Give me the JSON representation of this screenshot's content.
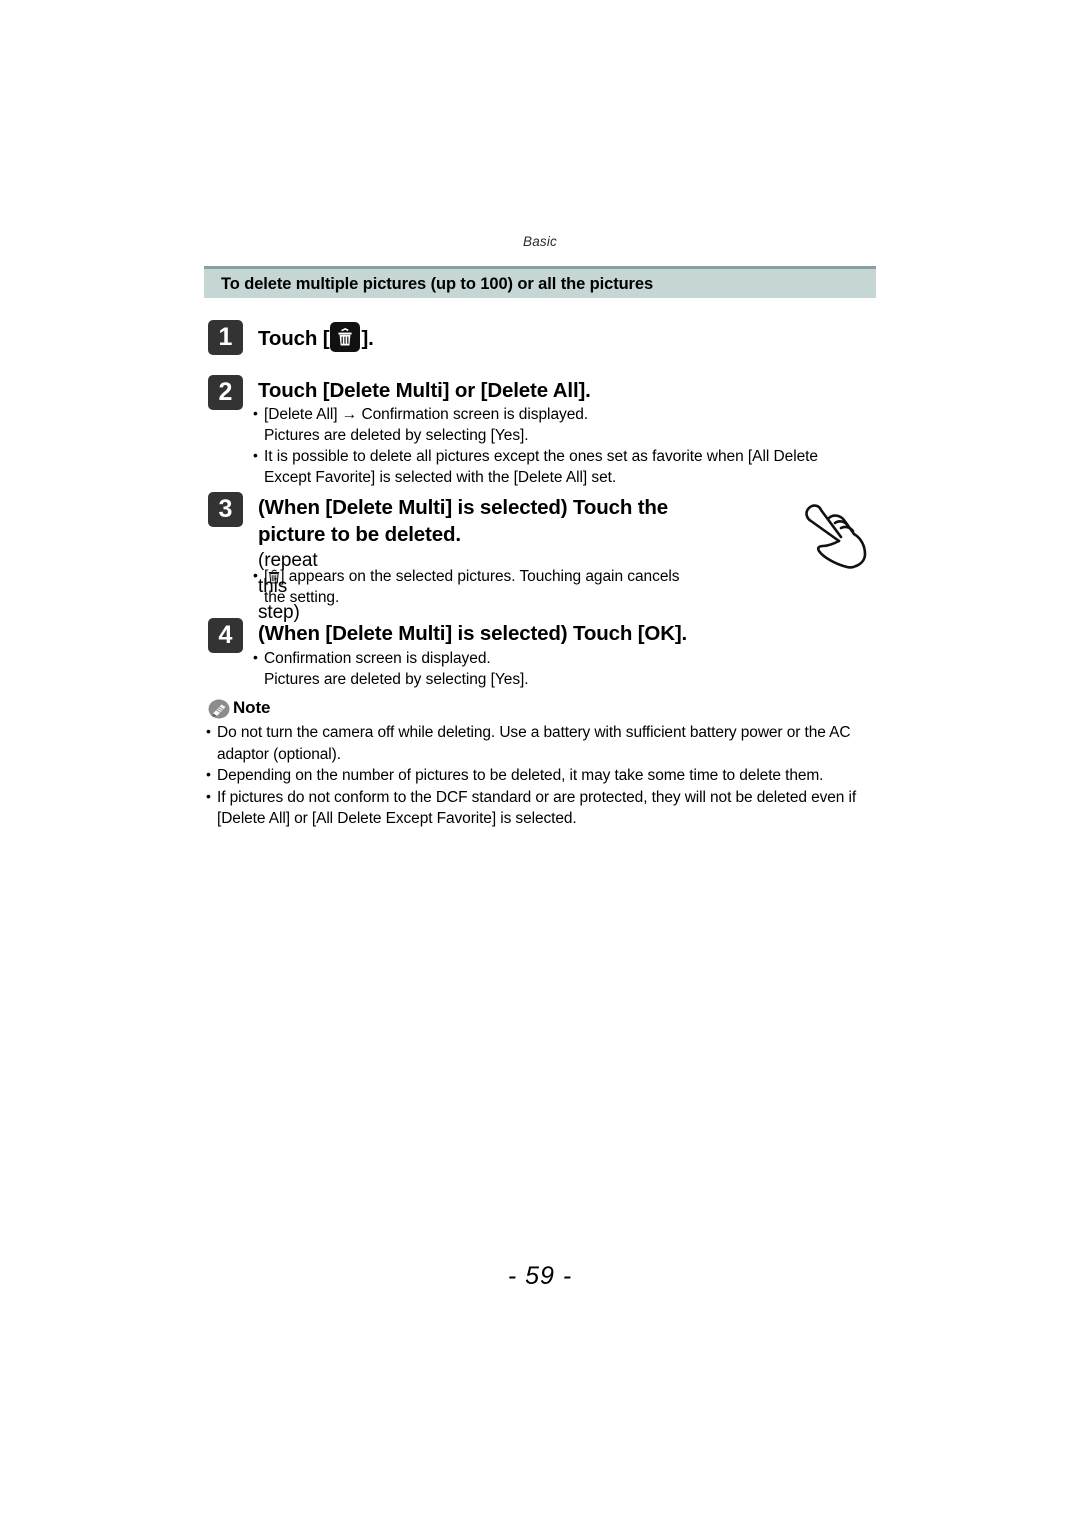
{
  "page": {
    "running_head": "Basic",
    "folio": "- 59 -"
  },
  "section": {
    "title": "To delete multiple pictures (up to 100) or all the pictures",
    "band_color": "#c6d6d4",
    "band_border_color": "#86a3a0"
  },
  "steps": [
    {
      "number": "1",
      "title_before_icon": "Touch [",
      "icon": "trash-icon",
      "title_after_icon": "].",
      "bullets": []
    },
    {
      "number": "2",
      "title": "Touch [Delete Multi] or [Delete All].",
      "bullets": [
        {
          "line1": "[Delete All] → Confirmation screen is displayed.",
          "line2": "Pictures are deleted by selecting [Yes]."
        },
        {
          "line1": "It is possible to delete all pictures except the ones set as favorite when  [All Delete",
          "line2": "Except Favorite]  is selected with the [Delete All] set."
        }
      ]
    },
    {
      "number": "3",
      "title": "(When [Delete Multi] is selected) Touch the picture to be deleted.",
      "subtitle": "(repeat this step)",
      "bullets": [
        {
          "prefix": "[",
          "icon": "trash-icon",
          "line1": "] appears on the selected pictures. Touching again cancels",
          "line2": "the setting."
        }
      ]
    },
    {
      "number": "4",
      "title": "(When [Delete Multi] is selected) Touch [OK].",
      "bullets": [
        {
          "line1": "Confirmation screen is displayed.",
          "line2": "Pictures are deleted by selecting [Yes]."
        }
      ]
    }
  ],
  "note": {
    "label": "Note",
    "icon": "pencil-icon",
    "bullets": [
      {
        "line1": "Do not turn the camera off while deleting. Use a battery with sufficient battery power or the AC",
        "line2": "adaptor (optional)."
      },
      {
        "line1": "Depending on the number of pictures to be deleted, it may take some time to delete them.",
        "line2": ""
      },
      {
        "line1": "If pictures do not conform to the DCF standard or are protected, they will not be deleted even if",
        "line2": "[Delete All] or [All Delete Except Favorite] is selected."
      }
    ]
  },
  "illustration": {
    "hand": "pointing-hand-icon"
  }
}
